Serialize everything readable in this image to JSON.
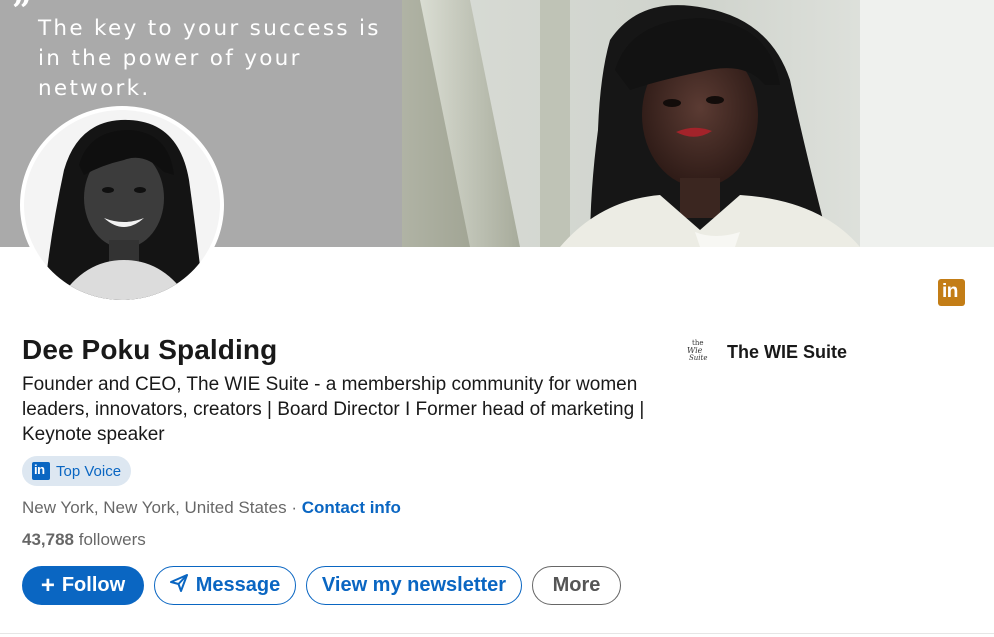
{
  "banner": {
    "quote_mark": "”",
    "quote": "The key to your success is in the power of your network."
  },
  "brand_icon": {
    "text": "in",
    "icon": "linkedin-icon",
    "color": "#c37d16"
  },
  "profile": {
    "name": "Dee Poku Spalding",
    "headline": "Founder and CEO, The WIE Suite - a membership community for women leaders, innovators, creators | Board Director I Former head of marketing | Keynote speaker",
    "badge": {
      "logo_text": "in",
      "label": "Top Voice"
    },
    "location": "New York, New York, United States",
    "separator": " · ",
    "contact_label": "Contact info",
    "followers_count": "43,788",
    "followers_label": " followers"
  },
  "company": {
    "logo_line1": "the",
    "logo_line2": "Wie",
    "logo_line3": "Suite",
    "name": "The WIE Suite"
  },
  "actions": {
    "follow_icon": "+",
    "follow_label": "Follow",
    "message_label": "Message",
    "newsletter_label": "View my newsletter",
    "more_label": "More"
  },
  "colors": {
    "primary": "#0a66c2",
    "badge_bg": "#dde7f1",
    "brand_icon": "#c37d16"
  }
}
